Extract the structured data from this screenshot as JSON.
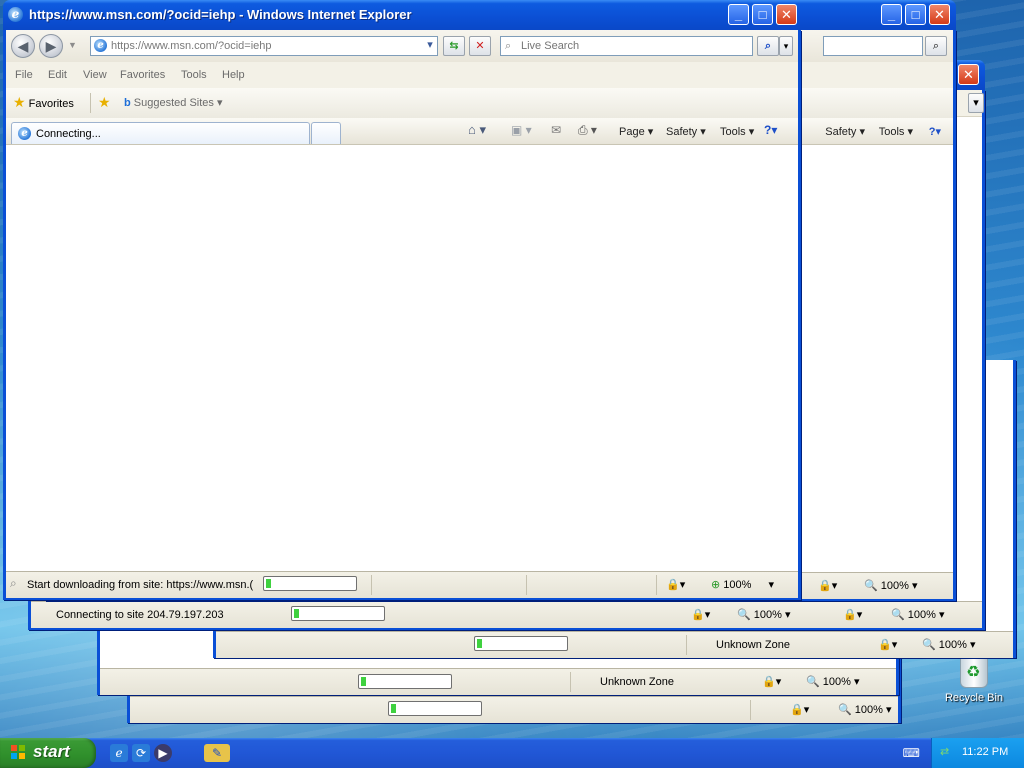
{
  "desktop": {
    "recycle_bin_label": "Recycle Bin"
  },
  "main_window": {
    "title": "https://www.msn.com/?ocid=iehp - Windows Internet Explorer",
    "address": "https://www.msn.com/?ocid=iehp",
    "search_placeholder": "Live Search",
    "menu": [
      "File",
      "Edit",
      "View",
      "Favorites",
      "Tools",
      "Help"
    ],
    "favorites_label": "Favorites",
    "suggested_sites_label": "Suggested Sites",
    "tab_label": "Connecting...",
    "commands": {
      "page": "Page",
      "safety": "Safety",
      "tools": "Tools"
    },
    "status_text": "Start downloading from site: https://www.msn.(",
    "zoom": "100%",
    "progress_fraction": 0.05
  },
  "back_windows": [
    {
      "name": "window-2",
      "commands": {
        "safety": "Safety",
        "tools": "Tools"
      },
      "zoom": "100%"
    },
    {
      "name": "window-3",
      "status_text": "Connecting to site 204.79.197.203",
      "zoom": "100%"
    },
    {
      "name": "window-4",
      "zone": "Unknown Zone",
      "zoom": "100%"
    },
    {
      "name": "window-5",
      "zone": "Unknown Zone",
      "zoom": "100%"
    },
    {
      "name": "window-6",
      "zoom": "100%"
    }
  ],
  "taskbar": {
    "start_label": "start",
    "clock": "11:22 PM"
  }
}
